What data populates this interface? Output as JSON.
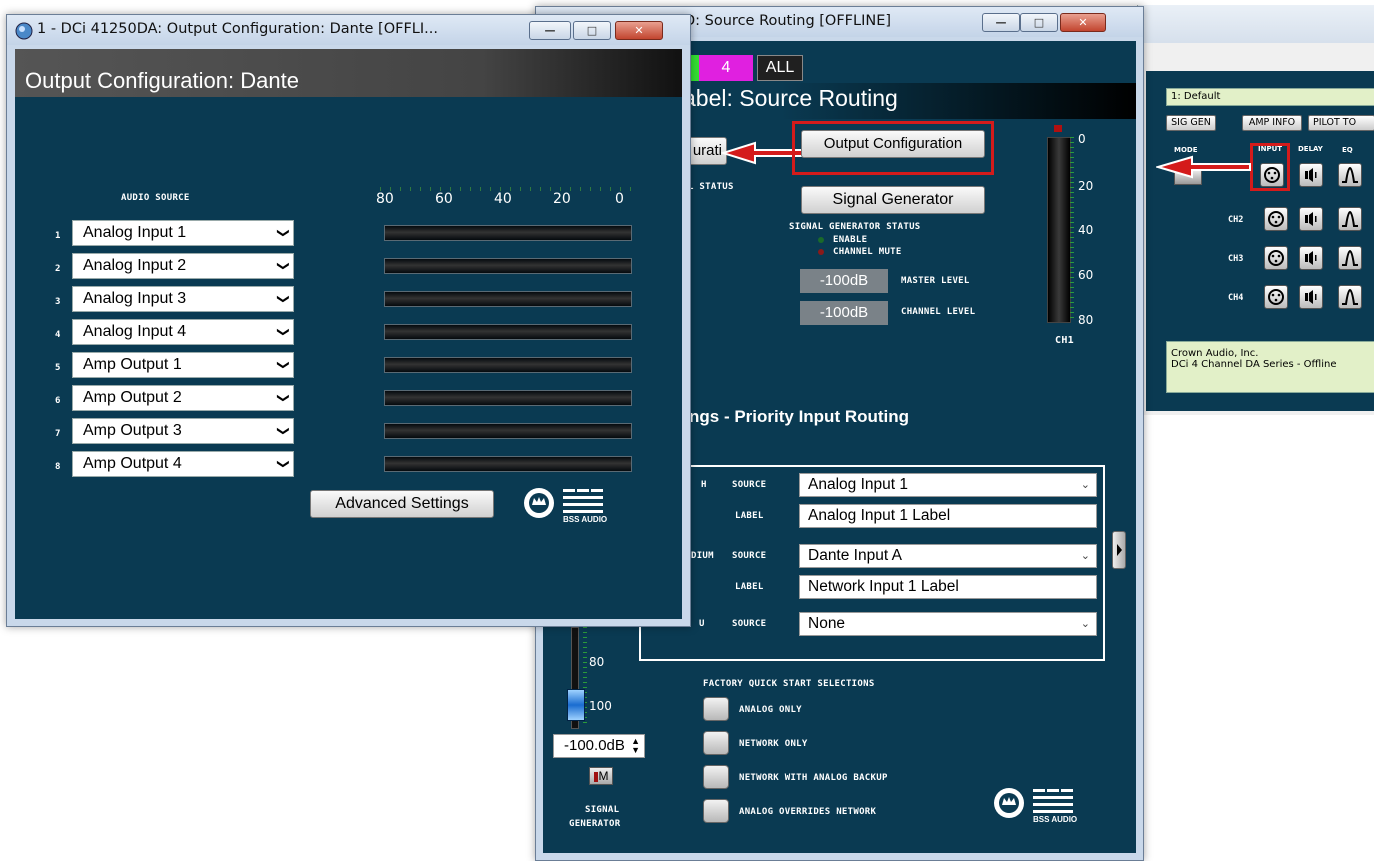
{
  "back_window": {
    "preset": "1: Default",
    "toolbar": [
      "SIG GEN",
      "AMP INFO",
      "PILOT TO"
    ],
    "col_labels": [
      "MODE",
      "INPUT",
      "DELAY",
      "EQ"
    ],
    "channels": [
      "CH2",
      "CH3",
      "CH4"
    ],
    "info": {
      "line1": "Crown Audio, Inc.",
      "line2": "DCi 4 Channel DA Series - Offline"
    }
  },
  "source_window": {
    "title": "D: Source Routing [OFFLINE]",
    "tabs": [
      "4",
      "ALL"
    ],
    "banner": "abel: Source Routing",
    "config_button_partial": "urati",
    "status_partial": "L STATUS",
    "output_config_button": "Output Configuration",
    "signal_gen_button": "Signal Generator",
    "siggen_status_title": "SIGNAL GENERATOR STATUS",
    "enable_label": "ENABLE",
    "channel_mute_label": "CHANNEL MUTE",
    "master_level": {
      "value": "-100dB",
      "label": "MASTER LEVEL"
    },
    "channel_level": {
      "value": "-100dB",
      "label": "CHANNEL LEVEL"
    },
    "meter_scale": [
      "0",
      "20",
      "40",
      "60",
      "80"
    ],
    "meter_channel": "CH1",
    "priority_heading": "ngs - Priority Input Routing",
    "rows": [
      {
        "prefix": "H",
        "source_label": "SOURCE",
        "source": "Analog Input 1",
        "label_label": "LABEL",
        "label": "Analog Input 1 Label"
      },
      {
        "prefix": "DIUM",
        "source_label": "SOURCE",
        "source": "Dante Input A",
        "label_label": "LABEL",
        "label": "Network Input 1 Label"
      },
      {
        "prefix": "U",
        "source_label": "SOURCE",
        "source": "None"
      }
    ],
    "fader_scale": [
      "80",
      "100"
    ],
    "fader_value": "-100.0dB",
    "mute_label": "M",
    "signal_generator_label": [
      "SIGNAL",
      "GENERATOR"
    ],
    "quick_start_title": "FACTORY QUICK START SELECTIONS",
    "quick_start": [
      "ANALOG ONLY",
      "NETWORK ONLY",
      "NETWORK WITH ANALOG BACKUP",
      "ANALOG OVERRIDES NETWORK"
    ],
    "logo_text": "BSS AUDIO"
  },
  "output_window": {
    "title": "1 - DCi 41250DA: Output Configuration: Dante [OFFLI...",
    "header": "Output Configuration: Dante",
    "audio_source_label": "AUDIO SOURCE",
    "scale": [
      "80",
      "60",
      "40",
      "20",
      "0"
    ],
    "outputs": [
      {
        "num": "1",
        "source": "Analog Input 1"
      },
      {
        "num": "2",
        "source": "Analog Input 2"
      },
      {
        "num": "3",
        "source": "Analog Input 3"
      },
      {
        "num": "4",
        "source": "Analog Input 4"
      },
      {
        "num": "5",
        "source": "Amp Output 1"
      },
      {
        "num": "6",
        "source": "Amp Output 2"
      },
      {
        "num": "7",
        "source": "Amp Output 3"
      },
      {
        "num": "8",
        "source": "Amp Output 4"
      }
    ],
    "advanced_button": "Advanced Settings",
    "logo_text": "BSS AUDIO"
  },
  "colors": {
    "panel": "#0a3a52",
    "highlight": "#d41b1b",
    "tab_green": "#33e033",
    "tab_magenta": "#e020e0"
  }
}
